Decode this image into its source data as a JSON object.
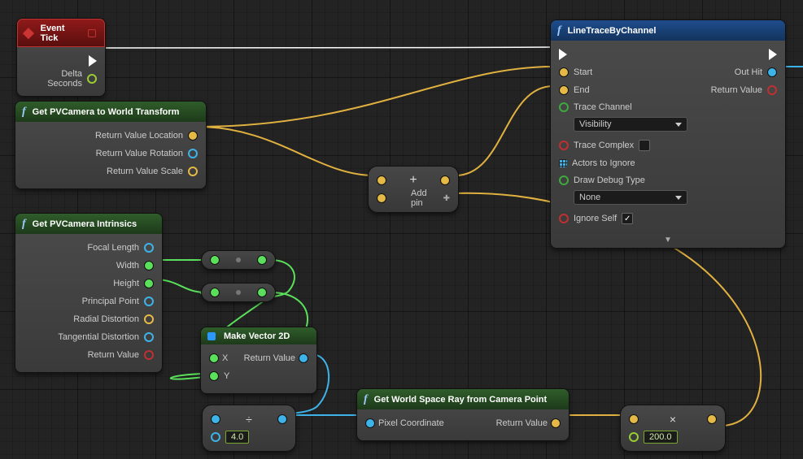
{
  "nodes": {
    "event_tick": {
      "title": "Event Tick",
      "outputs": {
        "delta_seconds": "Delta Seconds"
      }
    },
    "get_pvcamera_transform": {
      "title": "Get PVCamera to World Transform",
      "outputs": {
        "location": "Return Value Location",
        "rotation": "Return Value Rotation",
        "scale": "Return Value Scale"
      }
    },
    "get_pvcamera_intrinsics": {
      "title": "Get PVCamera Intrinsics",
      "outputs": {
        "focal_length": "Focal Length",
        "width": "Width",
        "height": "Height",
        "principal_point": "Principal Point",
        "radial_distortion": "Radial Distortion",
        "tangential_distortion": "Tangential Distortion",
        "return_value": "Return Value"
      }
    },
    "make_vector2d": {
      "title": "Make Vector 2D",
      "inputs": {
        "x": "X",
        "y": "Y"
      },
      "outputs": {
        "return_value": "Return Value"
      }
    },
    "get_world_ray": {
      "title": "Get World Space Ray from Camera Point",
      "inputs": {
        "pixel": "Pixel Coordinate"
      },
      "outputs": {
        "return_value": "Return Value"
      }
    },
    "line_trace": {
      "title": "LineTraceByChannel",
      "inputs": {
        "start": "Start",
        "end": "End",
        "trace_channel": "Trace Channel",
        "trace_channel_value": "Visibility",
        "trace_complex": "Trace Complex",
        "trace_complex_checked": false,
        "actors_to_ignore": "Actors to Ignore",
        "draw_debug_type": "Draw Debug Type",
        "draw_debug_value": "None",
        "ignore_self": "Ignore Self",
        "ignore_self_checked": true
      },
      "outputs": {
        "out_hit": "Out Hit",
        "return_value": "Return Value"
      }
    },
    "add": {
      "add_pin": "Add pin"
    },
    "op_divide_float": {
      "value": "4.0"
    },
    "op_mult_vec": {
      "value": "200.0"
    }
  }
}
